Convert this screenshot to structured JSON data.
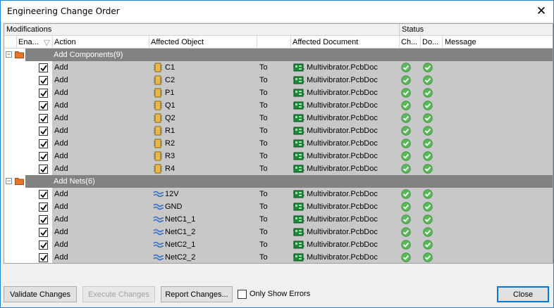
{
  "window": {
    "title": "Engineering Change Order",
    "close_glyph": "✕"
  },
  "bands": {
    "modifications": "Modifications",
    "status": "Status"
  },
  "columns": {
    "enable": "Ena...",
    "action": "Action",
    "affected_object": "Affected Object",
    "affected_document": "Affected Document",
    "check": "Ch...",
    "done": "Do...",
    "message": "Message"
  },
  "groups": [
    {
      "label": "Add Components(9)",
      "rows": [
        {
          "action": "Add",
          "object": "C1",
          "to": "To",
          "document": "Multivibrator.PcbDoc"
        },
        {
          "action": "Add",
          "object": "C2",
          "to": "To",
          "document": "Multivibrator.PcbDoc"
        },
        {
          "action": "Add",
          "object": "P1",
          "to": "To",
          "document": "Multivibrator.PcbDoc"
        },
        {
          "action": "Add",
          "object": "Q1",
          "to": "To",
          "document": "Multivibrator.PcbDoc"
        },
        {
          "action": "Add",
          "object": "Q2",
          "to": "To",
          "document": "Multivibrator.PcbDoc"
        },
        {
          "action": "Add",
          "object": "R1",
          "to": "To",
          "document": "Multivibrator.PcbDoc"
        },
        {
          "action": "Add",
          "object": "R2",
          "to": "To",
          "document": "Multivibrator.PcbDoc"
        },
        {
          "action": "Add",
          "object": "R3",
          "to": "To",
          "document": "Multivibrator.PcbDoc"
        },
        {
          "action": "Add",
          "object": "R4",
          "to": "To",
          "document": "Multivibrator.PcbDoc"
        }
      ]
    },
    {
      "label": "Add Nets(6)",
      "rows": [
        {
          "action": "Add",
          "object": "12V",
          "to": "To",
          "document": "Multivibrator.PcbDoc"
        },
        {
          "action": "Add",
          "object": "GND",
          "to": "To",
          "document": "Multivibrator.PcbDoc"
        },
        {
          "action": "Add",
          "object": "NetC1_1",
          "to": "To",
          "document": "Multivibrator.PcbDoc"
        },
        {
          "action": "Add",
          "object": "NetC1_2",
          "to": "To",
          "document": "Multivibrator.PcbDoc"
        },
        {
          "action": "Add",
          "object": "NetC2_1",
          "to": "To",
          "document": "Multivibrator.PcbDoc"
        },
        {
          "action": "Add",
          "object": "NetC2_2",
          "to": "To",
          "document": "Multivibrator.PcbDoc"
        }
      ]
    }
  ],
  "buttons": {
    "validate": "Validate Changes",
    "execute": "Execute Changes",
    "report": "Report Changes...",
    "close": "Close"
  },
  "only_show_errors": "Only Show Errors",
  "colors": {
    "accent": "#0078d7",
    "group_bar": "#828282",
    "row_shade": "#c8c8c8",
    "check_green": "#5cb85c"
  }
}
